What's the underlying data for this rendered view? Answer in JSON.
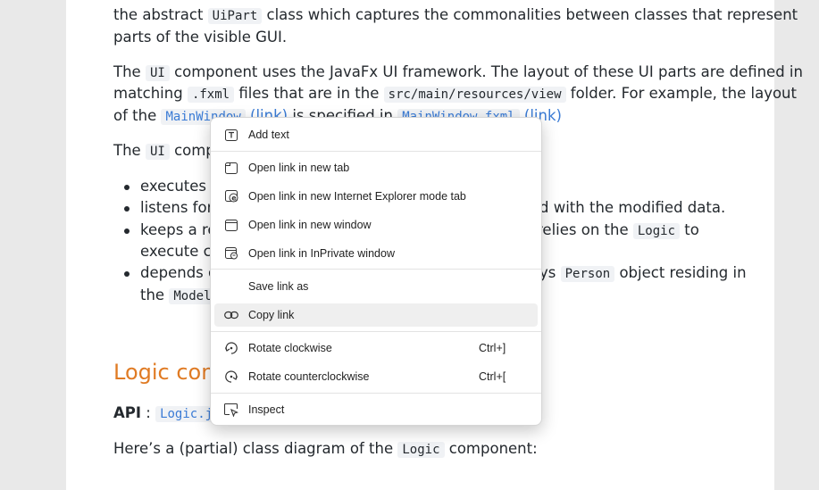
{
  "doc": {
    "p1_l1_a": "the abstract",
    "p1_l1_code": "UiPart",
    "p1_l1_b": "class which captures the commonalities between classes that represent",
    "p1_l2": "parts of the visible GUI.",
    "p2_l1_a": "The",
    "p2_l1_code": "UI",
    "p2_l1_b": "component uses the JavaFx UI framework. The layout of these UI parts are defined in",
    "p2_l2_a": "matching",
    "p2_l2_code1": ".fxml",
    "p2_l2_b": "files that are in the",
    "p2_l2_code2": "src/main/resources/view",
    "p2_l2_c": "folder. For example, the layout",
    "p2_l3_a": "of the",
    "p2_l3_code1": "MainWindow",
    "p2_l3_link1": "(link)",
    "p2_l3_b": "is specified in",
    "p2_l3_code2": "MainWindow.fxml",
    "p2_l3_link2": "(link)",
    "p3_a": "The",
    "p3_code": "UI",
    "p3_b": "compo",
    "b1": "executes us",
    "b2_a": "listens for c",
    "b2_b": "d with the modified data.",
    "b3_a": "keeps a ref",
    "b3_b": "relies on the",
    "b3_code": "Logic",
    "b3_c": "to",
    "b3_l2": "execute co",
    "b4_a": "depends o",
    "b4_b": "ys",
    "b4_code": "Person",
    "b4_c": "object residing in",
    "b4_l2_a": "the",
    "b4_l2_code": "Model",
    "heading": "Logic comp",
    "api_label": "API",
    "api_colon": ":",
    "api_code": "Logic.ja",
    "last_a": "Here’s a (partial) class diagram of the",
    "last_code": "Logic",
    "last_b": "component:"
  },
  "context_menu": {
    "items": [
      {
        "label": "Add text",
        "icon": "text-box-icon",
        "shortcut": ""
      },
      {
        "label": "Open link in new tab",
        "icon": "new-tab-icon",
        "shortcut": ""
      },
      {
        "label": "Open link in new Internet Explorer mode tab",
        "icon": "ie-icon",
        "shortcut": ""
      },
      {
        "label": "Open link in new window",
        "icon": "new-window-icon",
        "shortcut": ""
      },
      {
        "label": "Open link in InPrivate window",
        "icon": "inprivate-icon",
        "shortcut": ""
      },
      {
        "label": "Save link as",
        "icon": "",
        "shortcut": ""
      },
      {
        "label": "Copy link",
        "icon": "link-icon",
        "shortcut": ""
      },
      {
        "label": "Rotate clockwise",
        "icon": "rotate-clockwise-icon",
        "shortcut": "Ctrl+]"
      },
      {
        "label": "Rotate counterclockwise",
        "icon": "rotate-counterclockwise-icon",
        "shortcut": "Ctrl+["
      },
      {
        "label": "Inspect",
        "icon": "inspect-icon",
        "shortcut": ""
      }
    ],
    "hovered": "Copy link"
  },
  "colors": {
    "heading": "#e07b24",
    "link": "#3a7bd5",
    "code_bg": "#f0f2f5"
  }
}
